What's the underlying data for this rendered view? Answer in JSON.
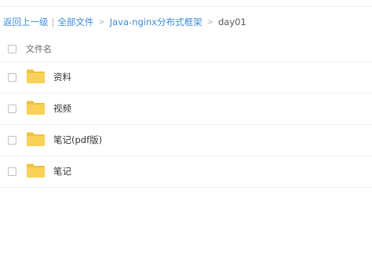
{
  "breadcrumb": {
    "back": "返回上一级",
    "separator": "|",
    "all_files": "全部文件",
    "arrow": ">",
    "folder": "Java-nginx分布式框架",
    "current": "day01"
  },
  "list": {
    "column_header": "文件名",
    "items": [
      {
        "name": "资料",
        "icon": "folder-icon"
      },
      {
        "name": "视频",
        "icon": "folder-icon"
      },
      {
        "name": "笔记(pdf版)",
        "icon": "folder-icon"
      },
      {
        "name": "笔记",
        "icon": "folder-icon"
      }
    ]
  },
  "colors": {
    "link": "#3b8cd9",
    "folder": "#f8d158",
    "folder_tab": "#f0c23b"
  }
}
